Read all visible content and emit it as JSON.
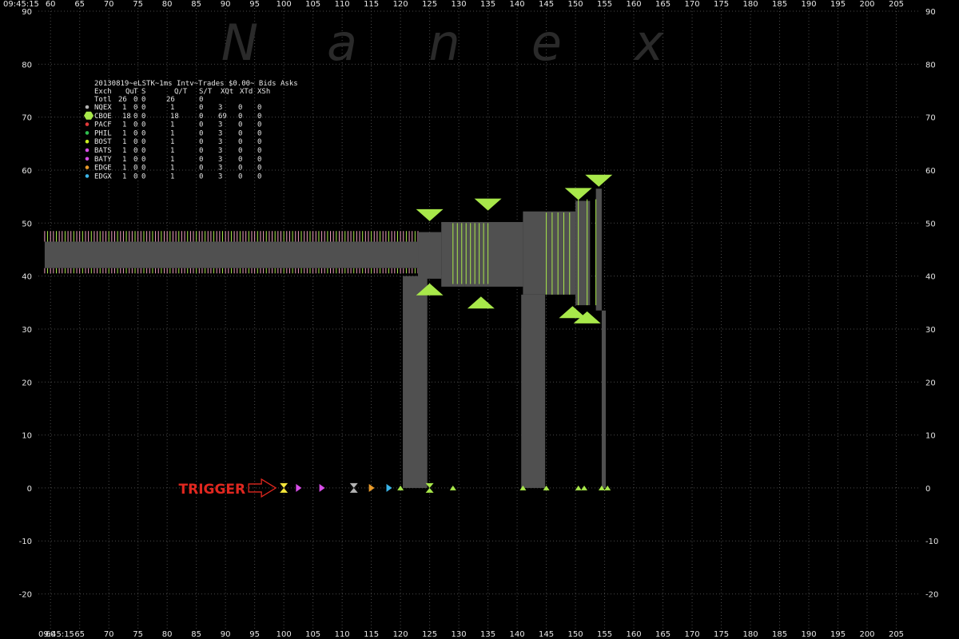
{
  "time_label": "09:45:15",
  "watermark": [
    "N",
    "a",
    "n",
    "e",
    "x"
  ],
  "annotation": "TRIGGER",
  "table": {
    "title": "20130819~eLSTK~1ms Intv~Trades $0.00~ Bids  Asks",
    "header": [
      "Exch",
      "Qu",
      "T",
      "S",
      "Q/T",
      "S/T",
      "XQt",
      "XTd",
      "XSh"
    ],
    "total": {
      "label": "Totl",
      "qu": "26",
      "t": "0",
      "s": "0",
      "qt": "26",
      "st": "0"
    },
    "rows": [
      {
        "exch": "NQEX",
        "color": "#b4b4b4",
        "qu": "1",
        "t": "0",
        "s": "0",
        "qt": "1",
        "st": "0",
        "xqt": "3",
        "xtd": "0",
        "xsh": "0"
      },
      {
        "exch": "CBOE",
        "color": "#a8e84a",
        "qu": "18",
        "t": "0",
        "s": "0",
        "qt": "18",
        "st": "0",
        "xqt": "69",
        "xtd": "0",
        "xsh": "0"
      },
      {
        "exch": "PACF",
        "color": "#e03a3a",
        "qu": "1",
        "t": "0",
        "s": "0",
        "qt": "1",
        "st": "0",
        "xqt": "3",
        "xtd": "0",
        "xsh": "0"
      },
      {
        "exch": "PHIL",
        "color": "#2fbf4f",
        "qu": "1",
        "t": "0",
        "s": "0",
        "qt": "1",
        "st": "0",
        "xqt": "3",
        "xtd": "0",
        "xsh": "0"
      },
      {
        "exch": "BOST",
        "color": "#c8ee20",
        "qu": "1",
        "t": "0",
        "s": "0",
        "qt": "1",
        "st": "0",
        "xqt": "3",
        "xtd": "0",
        "xsh": "0"
      },
      {
        "exch": "BATS",
        "color": "#d84ee8",
        "qu": "1",
        "t": "0",
        "s": "0",
        "qt": "1",
        "st": "0",
        "xqt": "3",
        "xtd": "0",
        "xsh": "0"
      },
      {
        "exch": "BATY",
        "color": "#d84ee8",
        "qu": "1",
        "t": "0",
        "s": "0",
        "qt": "1",
        "st": "0",
        "xqt": "3",
        "xtd": "0",
        "xsh": "0"
      },
      {
        "exch": "EDGE",
        "color": "#e89a2a",
        "qu": "1",
        "t": "0",
        "s": "0",
        "qt": "1",
        "st": "0",
        "xqt": "3",
        "xtd": "0",
        "xsh": "0"
      },
      {
        "exch": "EDGX",
        "color": "#3ab4e8",
        "qu": "1",
        "t": "0",
        "s": "0",
        "qt": "1",
        "st": "0",
        "xqt": "3",
        "xtd": "0",
        "xsh": "0"
      }
    ]
  },
  "chart_data": {
    "type": "line",
    "xlim": [
      56,
      210
    ],
    "ylim": [
      -27,
      90
    ],
    "x_ticks": [
      "60",
      "65",
      "70",
      "75",
      "80",
      "85",
      "90",
      "95",
      "100",
      "105",
      "110",
      "115",
      "120",
      "125",
      "130",
      "135",
      "140",
      "145",
      "150",
      "155",
      "160",
      "165",
      "170",
      "175",
      "180",
      "185",
      "190",
      "195",
      "200",
      "205"
    ],
    "y_ticks": [
      "90",
      "80",
      "70",
      "60",
      "50",
      "40",
      "30",
      "20",
      "10",
      "0",
      "-10",
      "-20"
    ],
    "grid": true,
    "colors": {
      "spread": "#505050",
      "nbbo": "#a8e84a",
      "pink": "#f0a0c0"
    },
    "pre_quotes": {
      "x_start": 59,
      "x_end": 123,
      "bid": 40.5,
      "ask": 48.5,
      "nbbo_bid": 41.5,
      "nbbo_ask": 46.5,
      "spacing": 0.5
    },
    "nbbo": [
      {
        "x0": 123,
        "x1": 127,
        "bid": 39.5,
        "ask": 48.3
      },
      {
        "x0": 127,
        "x1": 131,
        "bid": 38.0,
        "ask": 50.2
      },
      {
        "x0": 131,
        "x1": 141,
        "bid": 38.0,
        "ask": 50.2
      },
      {
        "x0": 141,
        "x1": 145,
        "bid": 36.5,
        "ask": 52.2
      },
      {
        "x0": 145,
        "x1": 150,
        "bid": 36.5,
        "ask": 52.2
      },
      {
        "x0": 150,
        "x1": 152.5,
        "bid": 34.5,
        "ask": 54.2
      },
      {
        "x0": 153.5,
        "x1": 154.5,
        "bid": 33.5,
        "ask": 56.5
      }
    ],
    "collapses": [
      {
        "x0": 120.4,
        "x1": 124.6,
        "y_top": 40
      },
      {
        "x0": 140.7,
        "x1": 144.8,
        "y_top": 36.5
      },
      {
        "x0": 154.5,
        "x1": 155.2,
        "y_top": 33.5
      }
    ],
    "cboe_lines": [
      {
        "x0": 129,
        "x1": 135,
        "y0": 38.5,
        "y1": 50,
        "n": 9
      },
      {
        "x0": 145,
        "x1": 149,
        "y0": 36.5,
        "y1": 52,
        "n": 5
      },
      {
        "x0": 150.5,
        "x1": 153.5,
        "y0": 34.5,
        "y1": 54.5,
        "n": 3
      }
    ],
    "ask_markers": [
      {
        "x": 125,
        "y": 51.5
      },
      {
        "x": 135,
        "y": 53.5
      },
      {
        "x": 150.5,
        "y": 55.5
      },
      {
        "x": 154,
        "y": 58
      }
    ],
    "bid_markers": [
      {
        "x": 125,
        "y": 37.5
      },
      {
        "x": 133.8,
        "y": 35
      },
      {
        "x": 149.5,
        "y": 33.2
      },
      {
        "x": 152,
        "y": 32.2
      }
    ],
    "zero_markers": [
      {
        "x": 100,
        "color": "#f5e63a",
        "shape": "hourglass"
      },
      {
        "x": 102.5,
        "color": "#d84ee8",
        "shape": "right"
      },
      {
        "x": 106.5,
        "color": "#d84ee8",
        "shape": "right"
      },
      {
        "x": 112,
        "color": "#b4b4b4",
        "shape": "hourglass"
      },
      {
        "x": 115,
        "color": "#e89a2a",
        "shape": "right"
      },
      {
        "x": 118,
        "color": "#3ab4e8",
        "shape": "right"
      },
      {
        "x": 120,
        "color": "#a8e84a",
        "shape": "up"
      },
      {
        "x": 125,
        "color": "#a8e84a",
        "shape": "hourglass"
      },
      {
        "x": 129,
        "color": "#a8e84a",
        "shape": "up"
      },
      {
        "x": 141,
        "color": "#a8e84a",
        "shape": "up"
      },
      {
        "x": 145,
        "color": "#a8e84a",
        "shape": "up"
      },
      {
        "x": 150.5,
        "color": "#a8e84a",
        "shape": "up"
      },
      {
        "x": 151.5,
        "color": "#a8e84a",
        "shape": "up"
      },
      {
        "x": 154.5,
        "color": "#a8e84a",
        "shape": "up"
      },
      {
        "x": 155.5,
        "color": "#a8e84a",
        "shape": "up"
      }
    ],
    "trigger_x": 100
  }
}
